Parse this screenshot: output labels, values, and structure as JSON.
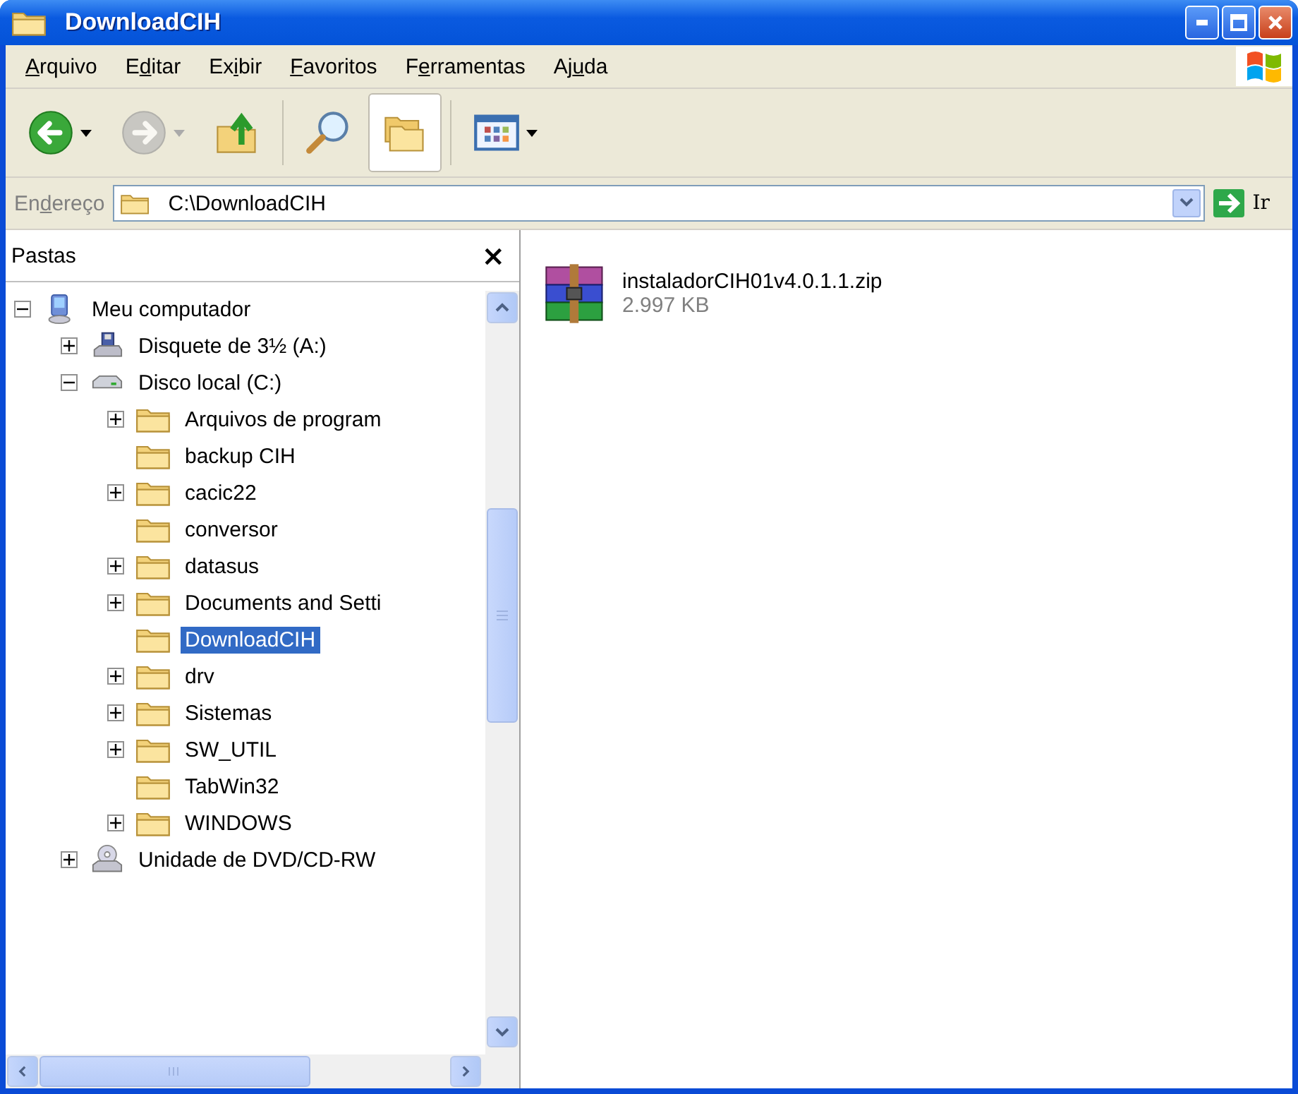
{
  "window": {
    "title": "DownloadCIH"
  },
  "menu": [
    {
      "key": "A",
      "after": "rquivo"
    },
    {
      "before": "E",
      "key": "d",
      "after": "itar"
    },
    {
      "before": "Ex",
      "key": "i",
      "after": "bir"
    },
    {
      "key": "F",
      "after": "avoritos"
    },
    {
      "before": "F",
      "key": "e",
      "after": "rramentas"
    },
    {
      "before": "Aj",
      "key": "u",
      "after": "da"
    }
  ],
  "toolbar": [
    {
      "kind": "back",
      "disabled": false,
      "pressed": false,
      "dropdown": true
    },
    {
      "kind": "forward",
      "disabled": true,
      "pressed": false,
      "dropdown": true
    },
    {
      "kind": "up",
      "disabled": false,
      "pressed": false,
      "dropdown": false
    },
    {
      "kind": "search",
      "disabled": false,
      "pressed": false,
      "dropdown": false
    },
    {
      "kind": "folders",
      "disabled": false,
      "pressed": true,
      "dropdown": false
    },
    {
      "kind": "views",
      "disabled": false,
      "pressed": false,
      "dropdown": true
    }
  ],
  "address": {
    "label": {
      "before": "En",
      "key": "d",
      "after": "ereço"
    },
    "value": "C:\\DownloadCIH",
    "go": "Ir"
  },
  "folders_pane": {
    "title": "Pastas",
    "close": "×"
  },
  "tree": [
    {
      "name": "Meu computador",
      "kind": "computer",
      "expandable": true,
      "expanded": true,
      "selected": false,
      "children": [
        {
          "name": "Disquete de 3½ (A:)",
          "kind": "floppy",
          "expandable": true,
          "expanded": false,
          "selected": false
        },
        {
          "name": "Disco local (C:)",
          "kind": "drive",
          "expandable": true,
          "expanded": true,
          "selected": false,
          "children": [
            {
              "name": "Arquivos de program",
              "kind": "folder",
              "expandable": true,
              "expanded": false,
              "selected": false
            },
            {
              "name": "backup CIH",
              "kind": "folder",
              "expandable": false,
              "selected": false
            },
            {
              "name": "cacic22",
              "kind": "folder",
              "expandable": true,
              "expanded": false,
              "selected": false
            },
            {
              "name": "conversor",
              "kind": "folder",
              "expandable": false,
              "selected": false
            },
            {
              "name": "datasus",
              "kind": "folder",
              "expandable": true,
              "expanded": false,
              "selected": false
            },
            {
              "name": "Documents and Setti",
              "kind": "folder",
              "expandable": true,
              "expanded": false,
              "selected": false
            },
            {
              "name": "DownloadCIH",
              "kind": "folder",
              "expandable": false,
              "selected": true
            },
            {
              "name": "drv",
              "kind": "folder",
              "expandable": true,
              "expanded": false,
              "selected": false
            },
            {
              "name": "Sistemas",
              "kind": "folder",
              "expandable": true,
              "expanded": false,
              "selected": false
            },
            {
              "name": "SW_UTIL",
              "kind": "folder",
              "expandable": true,
              "expanded": false,
              "selected": false
            },
            {
              "name": "TabWin32",
              "kind": "folder",
              "expandable": false,
              "selected": false
            },
            {
              "name": "WINDOWS",
              "kind": "folder",
              "expandable": true,
              "expanded": false,
              "selected": false
            }
          ]
        },
        {
          "name": "Unidade de DVD/CD-RW",
          "kind": "dvd",
          "expandable": true,
          "expanded": false,
          "selected": false
        }
      ]
    }
  ],
  "files": [
    {
      "name": "instaladorCIH01v4.0.1.1.zip",
      "size": "2.997 KB",
      "kind": "archive"
    }
  ]
}
